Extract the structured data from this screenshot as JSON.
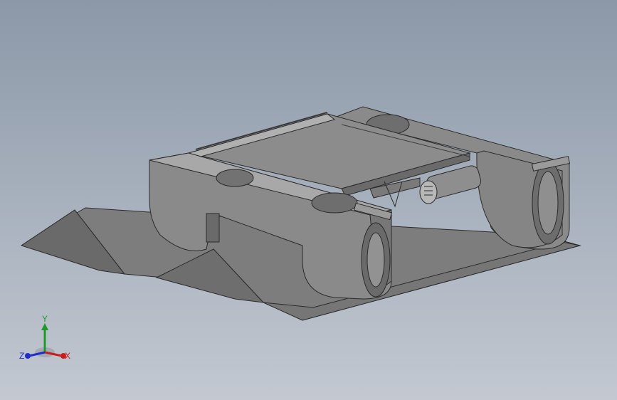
{
  "viewport": {
    "background_top": "#8c98a8",
    "background_bottom": "#c3c8d1",
    "model_color": "#8a8a8a"
  },
  "triad": {
    "x_label": "X",
    "y_label": "Y",
    "z_label": "Z",
    "x_color": "#c81e1e",
    "y_color": "#1e9a2a",
    "z_color": "#1e2ec8"
  }
}
